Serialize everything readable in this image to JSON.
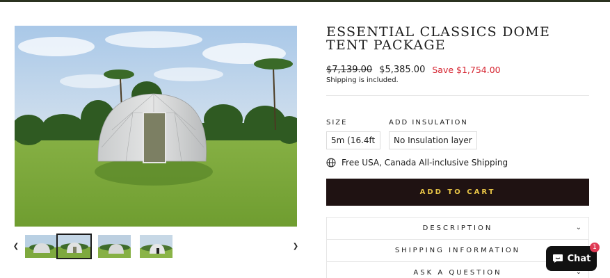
{
  "product": {
    "title": "ESSENTIAL CLASSICS DOME TENT PACKAGE",
    "price_compare": "$7,139.00",
    "price_current": "$5,385.00",
    "price_savings": "Save $1,754.00",
    "shipping_note": "Shipping is included."
  },
  "options": {
    "size_label": "SIZE",
    "size_value": "5m (16.4ft",
    "insulation_label": "ADD INSULATION",
    "insulation_value": "No Insulation layer"
  },
  "shipping_line": "Free USA, Canada All-inclusive Shipping",
  "add_to_cart_label": "ADD TO CART",
  "accordions": {
    "description": "DESCRIPTION",
    "shipping_info": "SHIPPING INFORMATION",
    "ask_question": "ASK A QUESTION"
  },
  "chat": {
    "label": "Chat",
    "badge_count": "1"
  },
  "gallery": {
    "thumbnail_count": 4,
    "active_thumbnail": 2,
    "prev_icon": "chevron-left-icon",
    "next_icon": "chevron-right-icon"
  },
  "colors": {
    "add_to_cart_bg": "#1f1212",
    "add_to_cart_text": "#e8c547",
    "sale_red": "#d5232f",
    "chat_badge": "#e03a54"
  }
}
